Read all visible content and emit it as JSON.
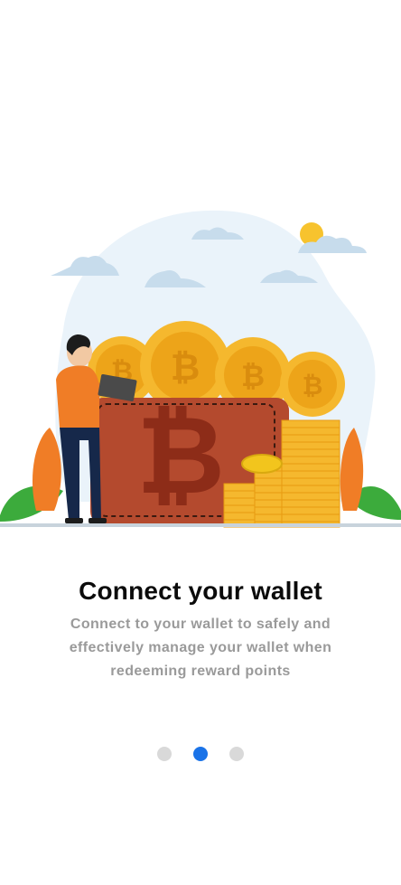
{
  "onboarding": {
    "title": "Connect your wallet",
    "description": "Connect to your wallet to safely and effectively manage your wallet when redeeming reward points",
    "pages": [
      {
        "active": false
      },
      {
        "active": true
      },
      {
        "active": false
      }
    ]
  },
  "colors": {
    "accent": "#1a73e8",
    "dot_inactive": "#d9d9d9",
    "title": "#0b0b0b",
    "description": "#9a9a9a",
    "coin": "#f5b82e",
    "wallet": "#b44a2e"
  },
  "icons": {
    "illustration": "wallet-with-bitcoin-coins-illustration"
  }
}
